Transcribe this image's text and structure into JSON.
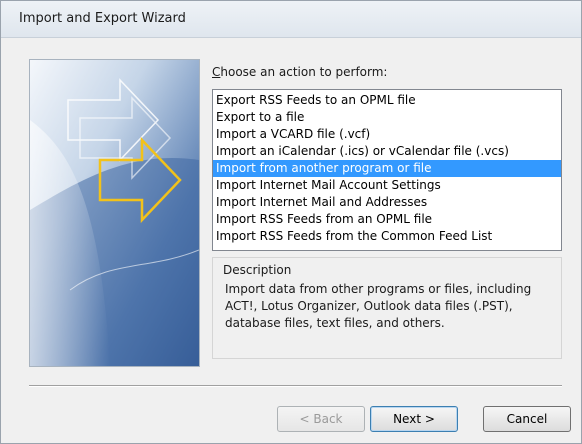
{
  "window": {
    "title": "Import and Export Wizard"
  },
  "prompt": {
    "label": "Choose an action to perform:",
    "mnemonic": "C",
    "rest": "hoose an action to perform:"
  },
  "actions": {
    "items": [
      {
        "label": "Export RSS Feeds to an OPML file",
        "selected": false
      },
      {
        "label": "Export to a file",
        "selected": false
      },
      {
        "label": "Import a VCARD file (.vcf)",
        "selected": false
      },
      {
        "label": "Import an iCalendar (.ics) or vCalendar file (.vcs)",
        "selected": false
      },
      {
        "label": "Import from another program or file",
        "selected": true
      },
      {
        "label": "Import Internet Mail Account Settings",
        "selected": false
      },
      {
        "label": "Import Internet Mail and Addresses",
        "selected": false
      },
      {
        "label": "Import RSS Feeds from an OPML file",
        "selected": false
      },
      {
        "label": "Import RSS Feeds from the Common Feed List",
        "selected": false
      }
    ]
  },
  "description": {
    "legend": "Description",
    "text": "Import data from other programs or files, including ACT!, Lotus Organizer, Outlook data files (.PST), database files, text files, and others."
  },
  "buttons": {
    "back": "< Back",
    "next": "Next >",
    "cancel": "Cancel"
  },
  "colors": {
    "selection": "#3399ff",
    "accent_arrow": "#f2c21a"
  }
}
